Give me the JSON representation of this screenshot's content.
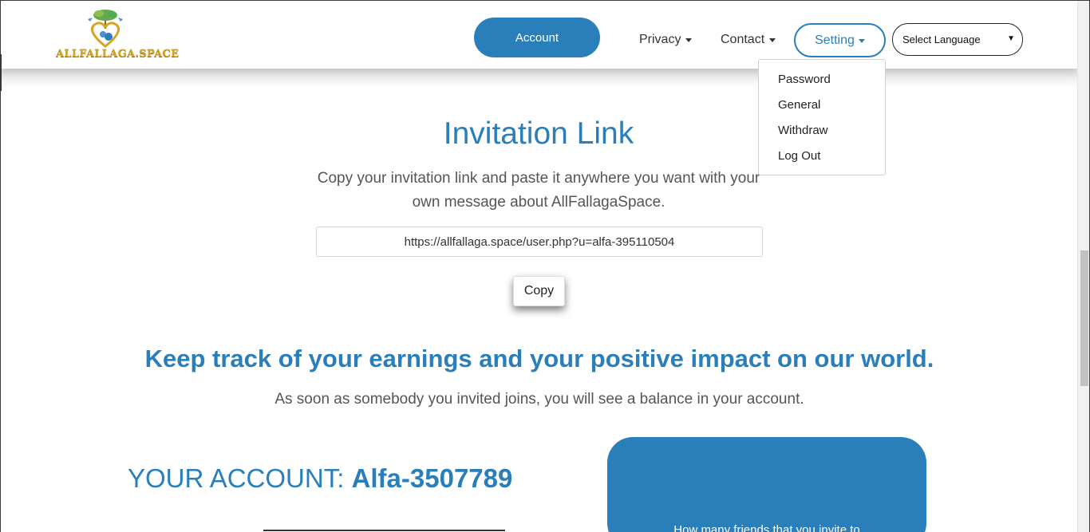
{
  "header": {
    "logo_text": "ALLFALLAGA.SPACE",
    "account_label": "Account",
    "nav": {
      "privacy_label": "Privacy",
      "contact_label": "Contact",
      "setting_label": "Setting"
    },
    "language_select": {
      "selected": "Select Language"
    }
  },
  "setting_menu": {
    "items": [
      "Password",
      "General",
      "Withdraw",
      "Log Out"
    ]
  },
  "invite": {
    "title": "Invitation Link",
    "description": "Copy your invitation link and paste it anywhere you want with your own message about AllFallagaSpace.",
    "link_value": "https://allfallaga.space/user.php?u=alfa-395110504",
    "copy_label": "Copy"
  },
  "track": {
    "title": "Keep track of your earnings and your positive impact on our world.",
    "description": "As soon as somebody you invited joins, you will see a balance in your account."
  },
  "account": {
    "label": "YOUR ACCOUNT:",
    "id": "Alfa-3507789"
  },
  "card": {
    "text": "How many friends that you invite to"
  },
  "colors": {
    "accent": "#2a7fba",
    "logo_gold": "#d4a52a"
  }
}
